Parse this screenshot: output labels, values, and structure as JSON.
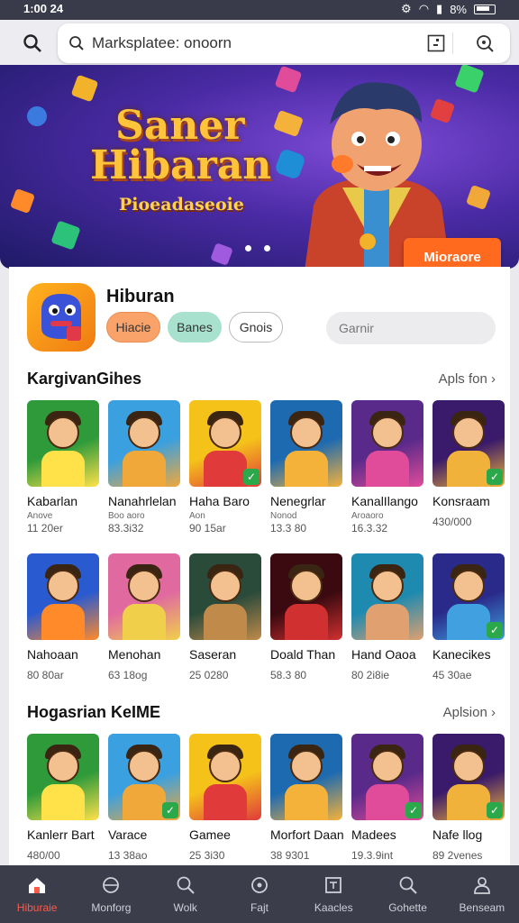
{
  "status_bar": {
    "time": "1:00 24",
    "battery": "8%"
  },
  "search": {
    "text": "Marksplatee: onoorn"
  },
  "banner": {
    "title_line1": "Saner",
    "title_line2": "Hibaran",
    "subtitle": "Pioeadaseoie",
    "more_button": "Mioraore"
  },
  "app": {
    "name": "Hiburan",
    "chips": [
      "Hiacie",
      "Banes",
      "Gnois"
    ],
    "search_placeholder": "Garnir"
  },
  "sections": [
    {
      "title": "KargivanGihes",
      "link": "Apls fon",
      "rows": [
        [
          {
            "name": "Kabarlan",
            "sub": "Anove",
            "size": "11 20er"
          },
          {
            "name": "Nanahrlelan",
            "sub": "Boo aoro",
            "size": "83.3i32"
          },
          {
            "name": "Haha Baro",
            "sub": "Aon",
            "size": "90 15ar"
          },
          {
            "name": "Nenegrlar",
            "sub": "Nonod",
            "size": "13.3 80"
          },
          {
            "name": "KanalIlango",
            "sub": "Aroaoro",
            "size": "16.3.32"
          },
          {
            "name": "Konsraam",
            "sub": "",
            "size": "430/000"
          }
        ],
        [
          {
            "name": "Nahoaan",
            "sub": "",
            "size": "80 80ar"
          },
          {
            "name": "Menohan",
            "sub": "",
            "size": "63 18og"
          },
          {
            "name": "Saseran",
            "sub": "",
            "size": "25 0280"
          },
          {
            "name": "Doald Than",
            "sub": "",
            "size": "58.3 80"
          },
          {
            "name": "Hand Oaoa",
            "sub": "",
            "size": "80 2i8ie"
          },
          {
            "name": "Kanecikes",
            "sub": "",
            "size": "45 30ae"
          }
        ]
      ]
    },
    {
      "title": "Hogasrian KeIME",
      "link": "Aplsion",
      "rows": [
        [
          {
            "name": "Kanlerr Bart",
            "sub": "",
            "size": "480/00"
          },
          {
            "name": "Varace",
            "sub": "",
            "size": "13 38ao"
          },
          {
            "name": "Gamee",
            "sub": "",
            "size": "25 3i30"
          },
          {
            "name": "Morfort Daan",
            "sub": "",
            "size": "38 9301"
          },
          {
            "name": "Madees",
            "sub": "",
            "size": "19.3.9int"
          },
          {
            "name": "Nafe llog",
            "sub": "",
            "size": "89 2venes"
          }
        ]
      ]
    }
  ],
  "bottom_nav": [
    "Hiburaie",
    "Monforg",
    "Wolk",
    "Fajt",
    "Kaacles",
    "Gohette",
    "Benseam"
  ],
  "colors": {
    "accent": "#ff6a1f",
    "nav_active": "#ff5a4a",
    "nav_bg": "#3c3d4b"
  }
}
